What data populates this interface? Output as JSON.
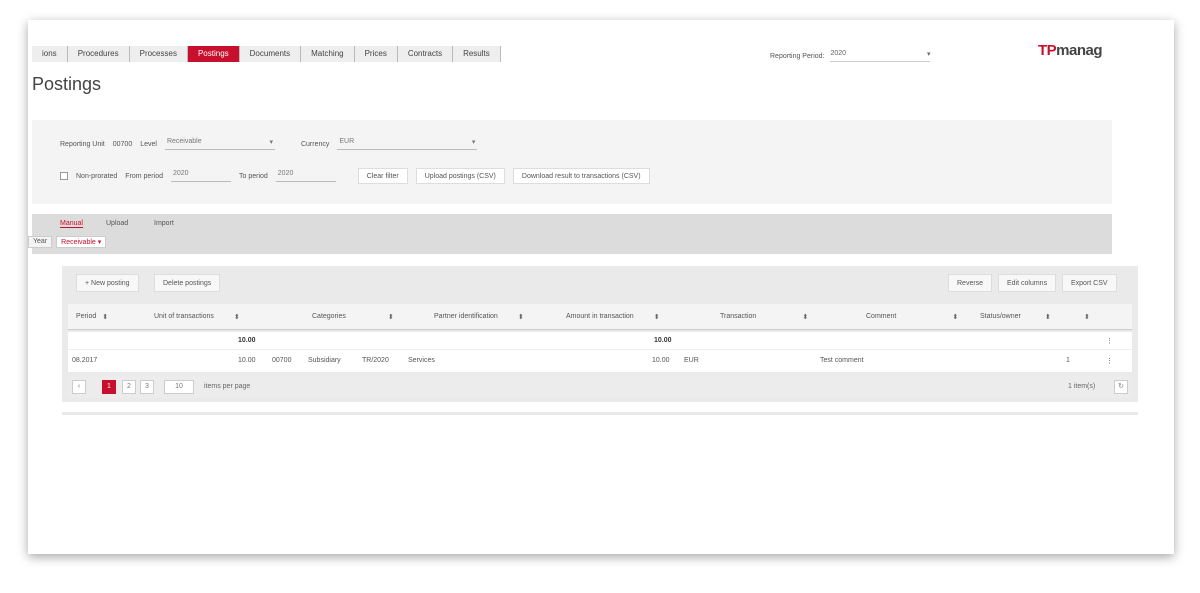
{
  "nav": {
    "tabs": [
      {
        "label": "ions",
        "active": false
      },
      {
        "label": "Procedures",
        "active": false
      },
      {
        "label": "Processes",
        "active": false
      },
      {
        "label": "Postings",
        "active": true
      },
      {
        "label": "Documents",
        "active": false
      },
      {
        "label": "Matching",
        "active": false
      },
      {
        "label": "Prices",
        "active": false
      },
      {
        "label": "Contracts",
        "active": false
      },
      {
        "label": "Results",
        "active": false
      }
    ],
    "period_label": "Reporting Period:",
    "period_value": "2020",
    "logo_mark": "TP",
    "logo_text": "manag"
  },
  "page": {
    "title": "Postings"
  },
  "filter": {
    "reporting_label": "Reporting Unit",
    "reporting_value": "00700",
    "level_label": "Level",
    "level_value": "Receivable",
    "currency_label": "Currency",
    "currency_value": "EUR",
    "checkbox_label": "Non-prorated",
    "from_label": "From period",
    "from_value": "2020",
    "to_label": "To period",
    "to_value": "2020",
    "btn_clear": "Clear filter",
    "btn_upload": "Upload postings (CSV)",
    "btn_download": "Download result to transactions (CSV)"
  },
  "subtabs": [
    "Manual",
    "Upload",
    "Import"
  ],
  "chips": {
    "first": "Year",
    "second": "Receivable"
  },
  "grid": {
    "toolbar": {
      "new": "+ New posting",
      "delete": "Delete postings",
      "reverse": "Reverse",
      "edit": "Edit columns",
      "export": "Export CSV"
    },
    "columns": [
      "Period",
      "Unit of transactions",
      "Categories",
      "Partner identification",
      "Amount in transaction",
      "Transaction",
      "Comment",
      "Status/owner"
    ],
    "sum_row": {
      "a": "10.00",
      "b": "10.00"
    },
    "rows": [
      {
        "period": "08.2017",
        "amount": "10.00",
        "unit": "00700",
        "partner": "Subsidiary",
        "ref": "TR/2020",
        "type": "Services",
        "amount2": "10.00",
        "currency": "EUR",
        "comment": "Test comment",
        "count": "1"
      }
    ],
    "pager": {
      "pages": [
        "1",
        "2",
        "3"
      ],
      "active": "1",
      "per_page": "10",
      "per_page_label": "items per page",
      "total": "1 item(s)"
    }
  }
}
